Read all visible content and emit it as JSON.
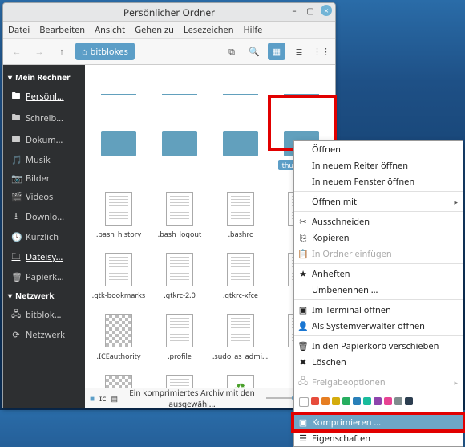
{
  "window": {
    "title": "Persönlicher Ordner"
  },
  "menu": {
    "items": [
      "Datei",
      "Bearbeiten",
      "Ansicht",
      "Gehen zu",
      "Lesezeichen",
      "Hilfe"
    ]
  },
  "toolbar": {
    "path_label": "bitblokes"
  },
  "sidebar": {
    "section1": "Mein Rechner",
    "items1": [
      {
        "icon": "🖿",
        "label": "Persönl…"
      },
      {
        "icon": "🖿",
        "label": "Schreib…"
      },
      {
        "icon": "🖿",
        "label": "Dokum…"
      },
      {
        "icon": "🎵",
        "label": "Musik"
      },
      {
        "icon": "📷",
        "label": "Bilder"
      },
      {
        "icon": "🎬",
        "label": "Videos"
      },
      {
        "icon": "⭳",
        "label": "Downlo…"
      },
      {
        "icon": "🕓",
        "label": "Kürzlich"
      },
      {
        "icon": "🗀",
        "label": "Dateisy…"
      },
      {
        "icon": "🗑",
        "label": "Papierk…"
      }
    ],
    "section2": "Netzwerk",
    "items2": [
      {
        "icon": "🖧",
        "label": "bitblok…"
      },
      {
        "icon": "⟳",
        "label": "Netzwerk"
      }
    ]
  },
  "grid": {
    "rows": [
      [
        {
          "type": "fld-top",
          "label": ""
        },
        {
          "type": "fld-top",
          "label": ""
        },
        {
          "type": "fld-top",
          "label": ""
        },
        {
          "type": "fld-top",
          "label": ""
        }
      ],
      [
        {
          "type": "fld",
          "label": ""
        },
        {
          "type": "fld",
          "label": ""
        },
        {
          "type": "fld",
          "label": ""
        },
        {
          "type": "fld",
          "label": ".thunderbird",
          "selected": true
        }
      ],
      [
        {
          "type": "doc",
          "label": ".bash_history"
        },
        {
          "type": "doc",
          "label": ".bash_logout"
        },
        {
          "type": "doc",
          "label": ".bashrc"
        },
        {
          "type": "doc",
          "label": ""
        }
      ],
      [
        {
          "type": "doc",
          "label": ".gtk-bookmarks"
        },
        {
          "type": "doc",
          "label": ".gtkrc-2.0"
        },
        {
          "type": "doc",
          "label": ".gtkrc-xfce"
        },
        {
          "type": "doc",
          "label": ""
        }
      ],
      [
        {
          "type": "chk",
          "label": ".ICEauthority"
        },
        {
          "type": "doc",
          "label": ".profile"
        },
        {
          "type": "doc",
          "label": ".sudo_as_admin_successful"
        },
        {
          "type": "doc",
          "label": ""
        }
      ],
      [
        {
          "type": "chk",
          "label": ""
        },
        {
          "type": "doc",
          "label": ""
        },
        {
          "type": "recycle",
          "label": ""
        },
        null
      ]
    ]
  },
  "status": {
    "text": "Ein komprimiertes Archiv mit den ausgewähl…",
    "sq": "■",
    "ic": "ɪᴄ"
  },
  "context_menu": {
    "items": [
      {
        "type": "item",
        "label": "Öffnen"
      },
      {
        "type": "item",
        "label": "In neuem Reiter öffnen"
      },
      {
        "type": "item",
        "label": "In neuem Fenster öffnen"
      },
      {
        "type": "sep"
      },
      {
        "type": "sub",
        "label": "Öffnen mit"
      },
      {
        "type": "sep"
      },
      {
        "type": "item",
        "icon": "✂",
        "label": "Ausschneiden"
      },
      {
        "type": "item",
        "icon": "⎘",
        "label": "Kopieren"
      },
      {
        "type": "item-dis",
        "icon": "📋",
        "label": "In Ordner einfügen"
      },
      {
        "type": "sep"
      },
      {
        "type": "item",
        "icon": "★",
        "label": "Anheften"
      },
      {
        "type": "item",
        "label": "Umbenennen …"
      },
      {
        "type": "sep"
      },
      {
        "type": "item",
        "icon": "▣",
        "label": "Im Terminal öffnen"
      },
      {
        "type": "item",
        "icon": "👤",
        "label": "Als Systemverwalter öffnen"
      },
      {
        "type": "sep"
      },
      {
        "type": "item",
        "icon": "🗑",
        "label": "In den Papierkorb verschieben"
      },
      {
        "type": "item",
        "icon": "✖",
        "label": "Löschen"
      },
      {
        "type": "sep"
      },
      {
        "type": "sub-dis",
        "icon": "🖧",
        "label": "Freigabeoptionen"
      },
      {
        "type": "sep"
      },
      {
        "type": "colors"
      },
      {
        "type": "sep"
      },
      {
        "type": "item-sel",
        "icon": "▣",
        "label": "Komprimieren …"
      },
      {
        "type": "item",
        "icon": "☰",
        "label": "Eigenschaften"
      }
    ],
    "colors": [
      "#fff",
      "#e74c3c",
      "#e67e22",
      "#d4ac0d",
      "#27ae60",
      "#2980b9",
      "#1abc9c",
      "#8e44ad",
      "#e84393",
      "#7f8c8d",
      "#2c3e50"
    ]
  }
}
